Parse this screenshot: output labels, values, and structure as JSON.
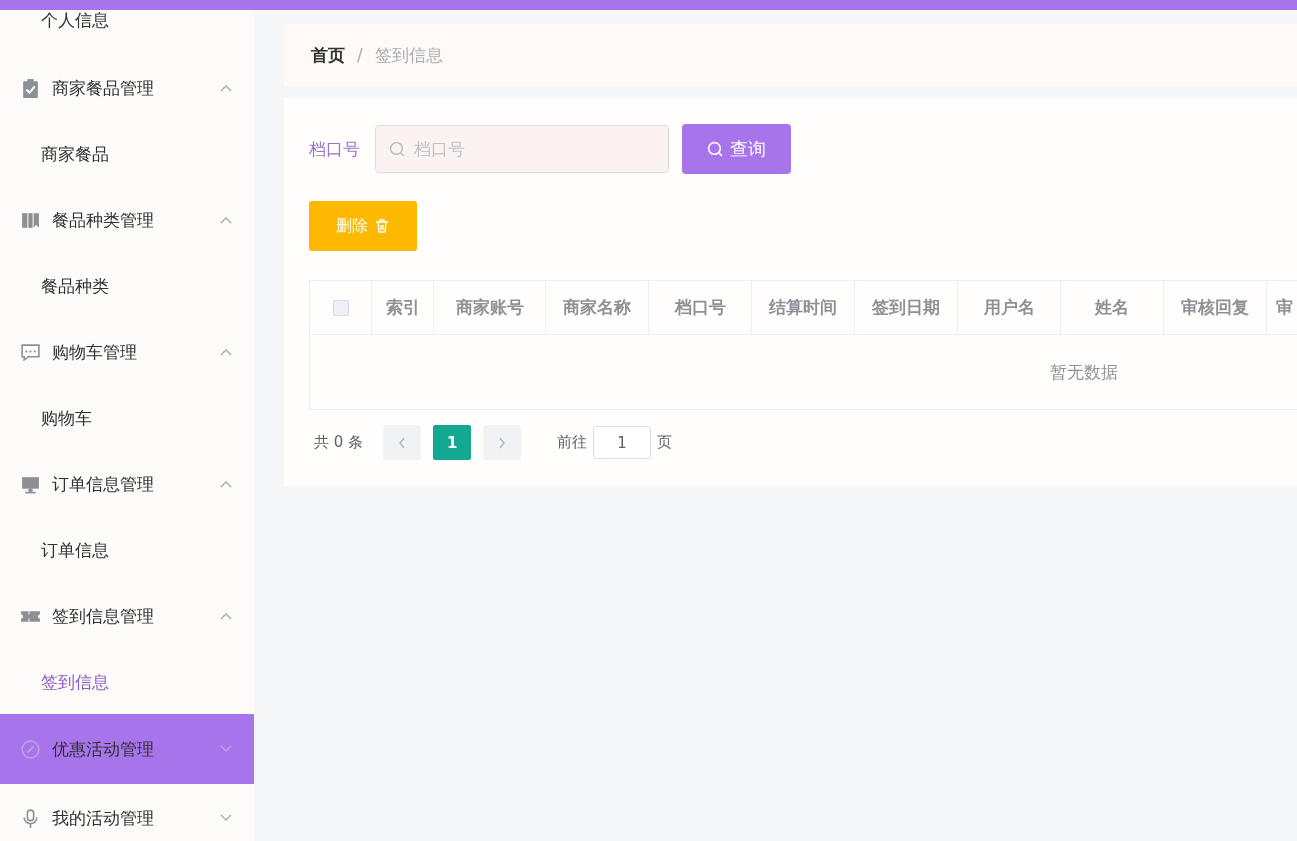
{
  "sidebar": {
    "items": [
      {
        "kind": "child",
        "label": "个人信息",
        "selected": false
      },
      {
        "kind": "group",
        "label": "商家餐品管理",
        "expanded": true,
        "hovered": false,
        "children": [
          {
            "label": "商家餐品",
            "selected": false
          }
        ]
      },
      {
        "kind": "group",
        "label": "餐品种类管理",
        "expanded": true,
        "hovered": false,
        "children": [
          {
            "label": "餐品种类",
            "selected": false
          }
        ]
      },
      {
        "kind": "group",
        "label": "购物车管理",
        "expanded": true,
        "hovered": false,
        "children": [
          {
            "label": "购物车",
            "selected": false
          }
        ]
      },
      {
        "kind": "group",
        "label": "订单信息管理",
        "expanded": true,
        "hovered": false,
        "children": [
          {
            "label": "订单信息",
            "selected": false
          }
        ]
      },
      {
        "kind": "group",
        "label": "签到信息管理",
        "expanded": true,
        "hovered": false,
        "children": [
          {
            "label": "签到信息",
            "selected": true
          }
        ]
      },
      {
        "kind": "group",
        "label": "优惠活动管理",
        "expanded": false,
        "hovered": true
      },
      {
        "kind": "group",
        "label": "我的活动管理",
        "expanded": false,
        "hovered": false
      }
    ]
  },
  "breadcrumb": [
    "首页",
    "/",
    "签到信息"
  ],
  "search": {
    "label": "档口号",
    "placeholder": "档口号",
    "button": "查询"
  },
  "delete_button": "删除",
  "table": {
    "select_all": {
      "checked": false
    },
    "columns": [
      "索引",
      "商家账号",
      "商家名称",
      "档口号",
      "结算时间",
      "签到日期",
      "用户名",
      "姓名",
      "审核回复",
      "审"
    ],
    "empty_text": "暂无数据"
  },
  "pagination": {
    "total": "共 0 条",
    "pages": [
      {
        "label": "1",
        "selected": true
      }
    ],
    "goto_label": "前往",
    "goto_value": "1",
    "goto_suffix": "页"
  }
}
